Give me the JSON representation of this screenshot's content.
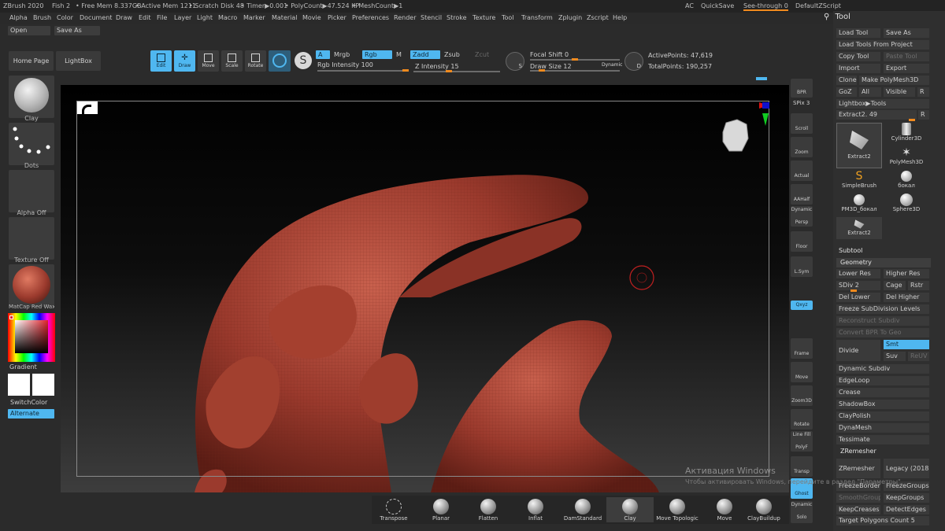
{
  "titlebar": {
    "items": [
      "ZBrush 2020",
      "Fish 2",
      "• Free Mem 8.337GB",
      "• Active Mem 1211",
      "• Scratch Disk 48",
      "• Timer▶0.001",
      "• PolyCount▶47.524 KP",
      "• MeshCount▶1"
    ],
    "ac": "AC",
    "quicksave": "QuickSave",
    "seethrough": "See-through  0",
    "default_zscript": "DefaultZScript"
  },
  "menu": [
    "Alpha",
    "Brush",
    "Color",
    "Document",
    "Draw",
    "Edit",
    "File",
    "Layer",
    "Light",
    "Macro",
    "Marker",
    "Material",
    "Movie",
    "Picker",
    "Preferences",
    "Render",
    "Stencil",
    "Stroke",
    "Texture",
    "Tool",
    "Transform",
    "Zplugin",
    "Zscript",
    "Help"
  ],
  "file_buttons": {
    "open": "Open",
    "save_as": "Save As"
  },
  "home": {
    "home_page": "Home Page",
    "lightbox": "LightBox"
  },
  "modes": {
    "edit": "Edit",
    "draw": "Draw",
    "move": "Move",
    "scale": "Scale",
    "rotate": "Rotate"
  },
  "color_controls": {
    "a": "A",
    "mrgb": "Mrgb",
    "rgb": "Rgb",
    "m": "M",
    "rgb_intensity": "Rgb Intensity 100",
    "zadd": "Zadd",
    "zsub": "Zsub",
    "zcut": "Zcut",
    "z_intensity": "Z Intensity 15",
    "rgb_intensity_value": 100,
    "z_intensity_value": 15
  },
  "focal": {
    "focal_shift": "Focal Shift 0",
    "draw_size": "Draw Size 12",
    "dynamic": "Dynamic",
    "s_label": "S",
    "d_label": "D"
  },
  "points": {
    "active": "ActivePoints: 47,619",
    "total": "TotalPoints: 190,257"
  },
  "left_shelf": {
    "brush_label": "Clay",
    "stroke_label": "Dots",
    "alpha_label": "Alpha Off",
    "texture_label": "Texture Off",
    "material_label": "MatCap Red Wax",
    "gradient": "Gradient",
    "switch_color": "SwitchColor",
    "alternate": "Alternate"
  },
  "right_strip": {
    "bpr": "BPR",
    "spix": "SPix 3",
    "scroll": "Scroll",
    "zoom": "Zoom",
    "actual": "Actual",
    "aahalf": "AAHalf",
    "dynamic": "Dynamic",
    "persp": "Persp",
    "floor": "Floor",
    "lsym": "L.Sym",
    "xyz": "Qxyz",
    "frame": "Frame",
    "move": "Move",
    "zoom3d": "Zoom3D",
    "rotate": "Rotate",
    "line_fill": "Line Fill",
    "polyf": "PolyF",
    "transp": "Transp",
    "ghost": "Ghost",
    "solo": "Solo",
    "dynamic2": "Dynamic"
  },
  "tool_panel": {
    "title": "Tool",
    "load_tool": "Load Tool",
    "save_as": "Save As",
    "load_from_project": "Load Tools From Project",
    "copy_tool": "Copy Tool",
    "paste_tool": "Paste Tool",
    "import": "Import",
    "export": "Export",
    "clone": "Clone",
    "make_polymesh": "Make PolyMesh3D",
    "goz": "GoZ",
    "all": "All",
    "visible": "Visible",
    "r": "R",
    "lightbox_tools": "Lightbox▶Tools",
    "extract_slider": "Extract2. 49",
    "extract_value": 49,
    "tiles": [
      "Extract2",
      "Cylinder3D",
      "PolyMesh3D",
      "SimpleBrush",
      "бокал",
      "PM3D_бокал",
      "Sphere3D",
      "Extract2"
    ],
    "subtool": "Subtool",
    "geometry": "Geometry",
    "lower_res": "Lower Res",
    "higher_res": "Higher Res",
    "sdiv": "SDiv 2",
    "cage": "Cage",
    "rstr": "Rstr",
    "del_lower": "Del Lower",
    "del_higher": "Del Higher",
    "freeze_subdiv": "Freeze SubDivision Levels",
    "reconstruct": "Reconstruct Subdiv",
    "convert_bpr": "Convert BPR To Geo",
    "divide": "Divide",
    "smt": "Smt",
    "suv": "Suv",
    "reuv": "ReUV",
    "dynamic_subdiv": "Dynamic Subdiv",
    "edgeloop": "EdgeLoop",
    "crease": "Crease",
    "shadowbox": "ShadowBox",
    "claypolish": "ClayPolish",
    "dynamesh": "DynaMesh",
    "tessimate": "Tessimate",
    "zremesher_section": "ZRemesher",
    "zremesher": "ZRemesher",
    "legacy": "Legacy (2018)",
    "freeze_border": "FreezeBorder",
    "freeze_groups": "FreezeGroups",
    "smooth_groups": "SmoothGroups",
    "keep_groups": "KeepGroups",
    "keep_creases": "KeepCreases",
    "detect_edges": "DetectEdges",
    "target_polys": "Target Polygons Count 5"
  },
  "brushes": [
    "Transpose",
    "Planar",
    "Flatten",
    "Inflat",
    "DamStandard",
    "Clay",
    "Move Topologic",
    "Move",
    "ClayBuildup"
  ],
  "watermark": {
    "line1": "Активация Windows",
    "line2": "Чтобы активировать Windows, перейдите в раздел \"Параметры\"."
  },
  "colors": {
    "accent": "#4fb7f0",
    "slider_knob": "#f08a1e",
    "model": "#9b3a2d"
  }
}
